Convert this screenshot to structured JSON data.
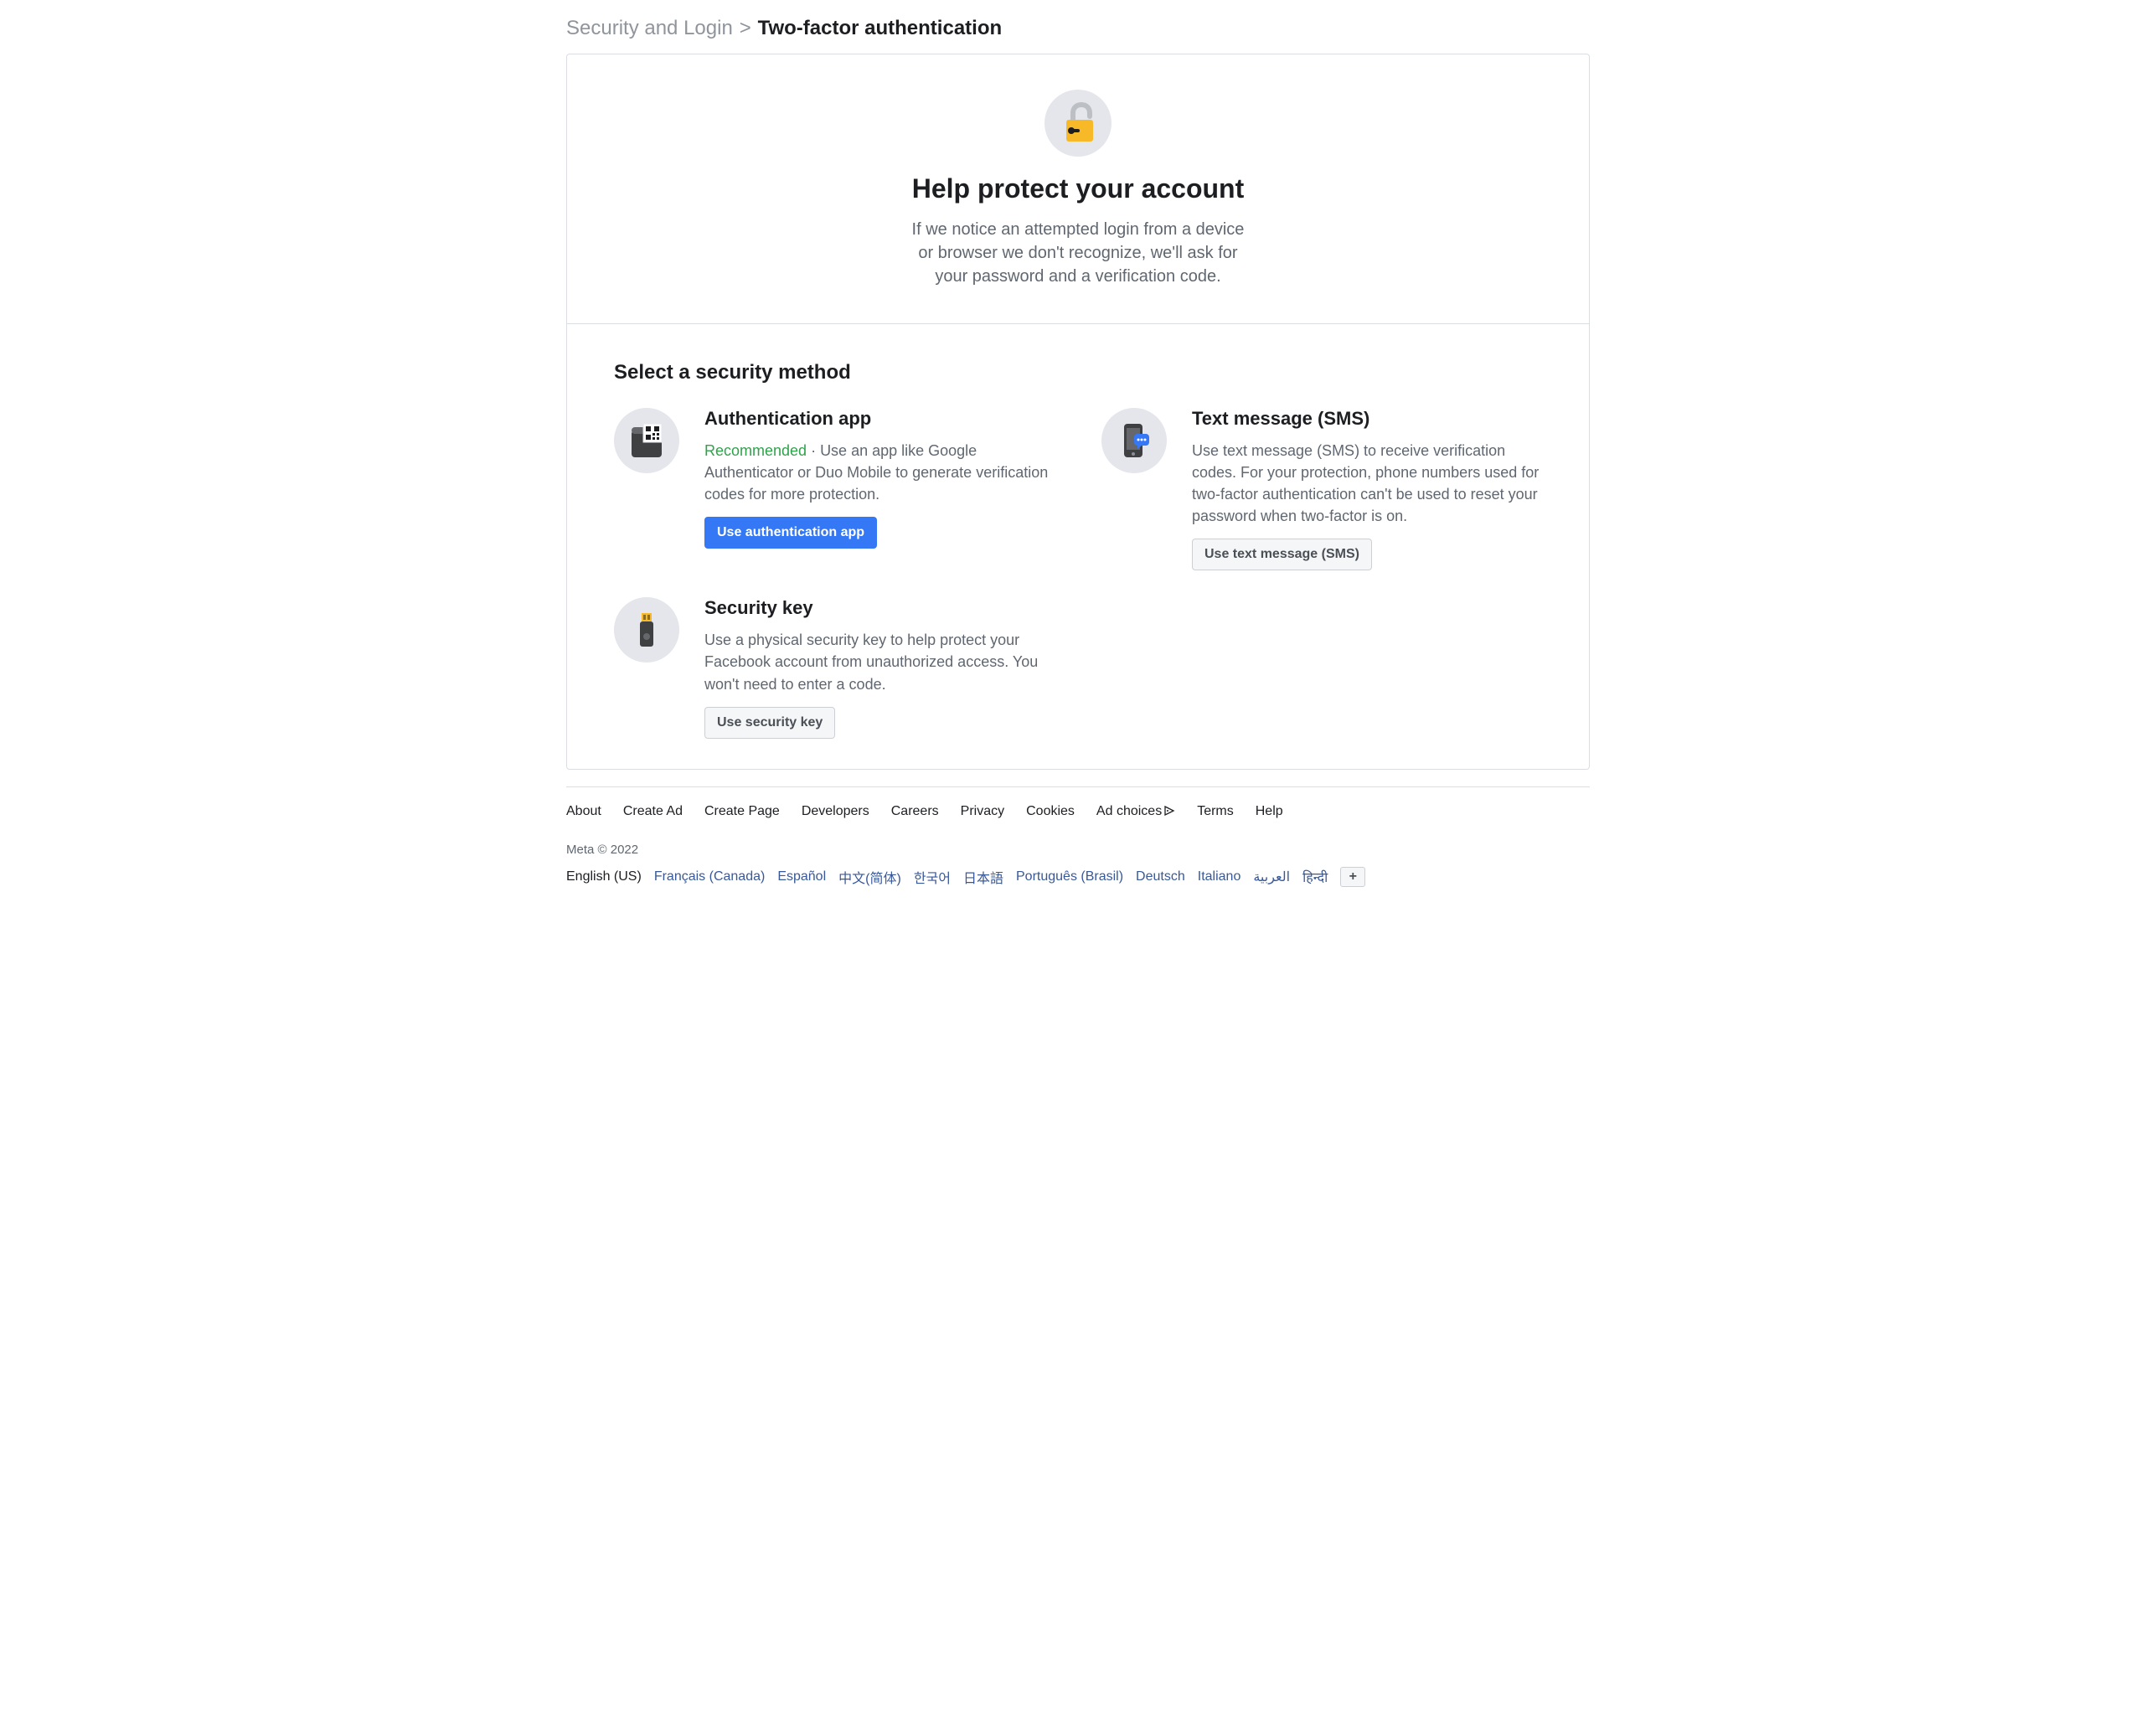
{
  "breadcrumb": {
    "parent": "Security and Login",
    "separator": ">",
    "current": "Two-factor authentication"
  },
  "hero": {
    "title": "Help protect your account",
    "description": "If we notice an attempted login from a device or browser we don't recognize, we'll ask for your password and a verification code."
  },
  "methods_heading": "Select a security method",
  "methods": {
    "auth_app": {
      "title": "Authentication app",
      "recommended_label": "Recommended",
      "separator": " · ",
      "description": "Use an app like Google Authenticator or Duo Mobile to generate verification codes for more protection.",
      "button": "Use authentication app"
    },
    "sms": {
      "title": "Text message (SMS)",
      "description": "Use text message (SMS) to receive verification codes. For your protection, phone numbers used for two-factor authentication can't be used to reset your password when two-factor is on.",
      "button": "Use text message (SMS)"
    },
    "security_key": {
      "title": "Security key",
      "description": "Use a physical security key to help protect your Facebook account from unauthorized access. You won't need to enter a code.",
      "button": "Use security key"
    }
  },
  "footer": {
    "links": {
      "about": "About",
      "create_ad": "Create Ad",
      "create_page": "Create Page",
      "developers": "Developers",
      "careers": "Careers",
      "privacy": "Privacy",
      "cookies": "Cookies",
      "ad_choices": "Ad choices",
      "terms": "Terms",
      "help": "Help"
    },
    "copyright": "Meta © 2022",
    "languages": [
      "English (US)",
      "Français (Canada)",
      "Español",
      "中文(简体)",
      "한국어",
      "日本語",
      "Português (Brasil)",
      "Deutsch",
      "Italiano",
      "العربية",
      "हिन्दी"
    ],
    "add_lang_label": "+"
  }
}
